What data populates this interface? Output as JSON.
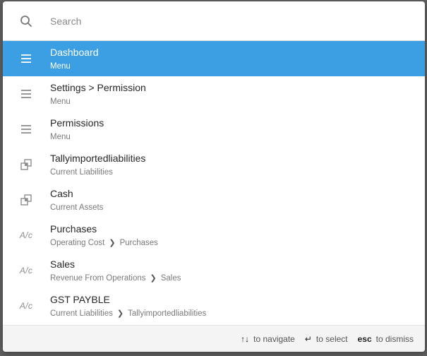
{
  "search": {
    "placeholder": "Search"
  },
  "results": [
    {
      "icon": "menu-icon",
      "title": "Dashboard",
      "path": [
        "Menu"
      ],
      "active": true
    },
    {
      "icon": "menu-icon",
      "title": "Settings > Permission",
      "path": [
        "Menu"
      ]
    },
    {
      "icon": "menu-icon",
      "title": "Permissions",
      "path": [
        "Menu"
      ]
    },
    {
      "icon": "group-icon",
      "title": "Tallyimportedliabilities",
      "path": [
        "Current Liabilities"
      ]
    },
    {
      "icon": "group-icon",
      "title": "Cash",
      "path": [
        "Current Assets"
      ]
    },
    {
      "icon": "account-icon",
      "icon_text": "A/c",
      "title": "Purchases",
      "path": [
        "Operating Cost",
        "Purchases"
      ]
    },
    {
      "icon": "account-icon",
      "icon_text": "A/c",
      "title": "Sales",
      "path": [
        "Revenue From Operations",
        "Sales"
      ]
    },
    {
      "icon": "account-icon",
      "icon_text": "A/c",
      "title": "GST PAYBLE",
      "path": [
        "Current Liabilities",
        "Tallyimportedliabilities"
      ]
    }
  ],
  "footer": {
    "navigate_key": "↑↓",
    "navigate_label": "to navigate",
    "select_key": "↵",
    "select_label": "to select",
    "dismiss_key": "esc",
    "dismiss_label": "to dismiss"
  },
  "colors": {
    "active": "#3d9fe3"
  }
}
